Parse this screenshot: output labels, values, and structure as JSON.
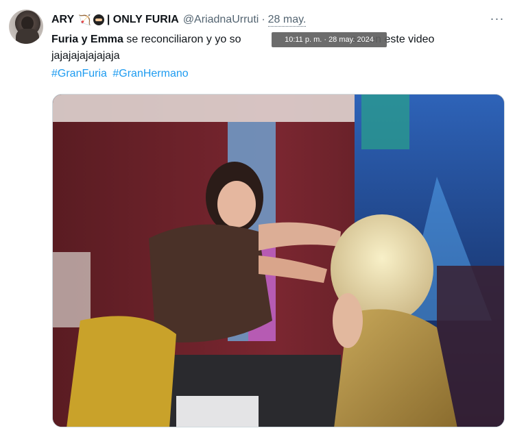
{
  "tweet": {
    "author_name": "ARY",
    "author_suffix": "| ONLY FURIA",
    "handle": "@AriadnaUrruti",
    "dot": "·",
    "date": "28 may.",
    "more_icon_glyph": "···",
    "text_bold": "Furia y Emma",
    "text_part1": " se reconciliaron y yo so",
    "text_part2": "sar en este video jajajajajajajaja",
    "hashtags": [
      "#GranFuria",
      "#GranHermano"
    ],
    "tooltip": "10:11 p. m. · 28 may. 2024",
    "emoji_icons": [
      "bow-and-arrow-icon",
      "ninja-icon"
    ],
    "link_color": "#1d9bf0",
    "muted_color": "#536471"
  }
}
